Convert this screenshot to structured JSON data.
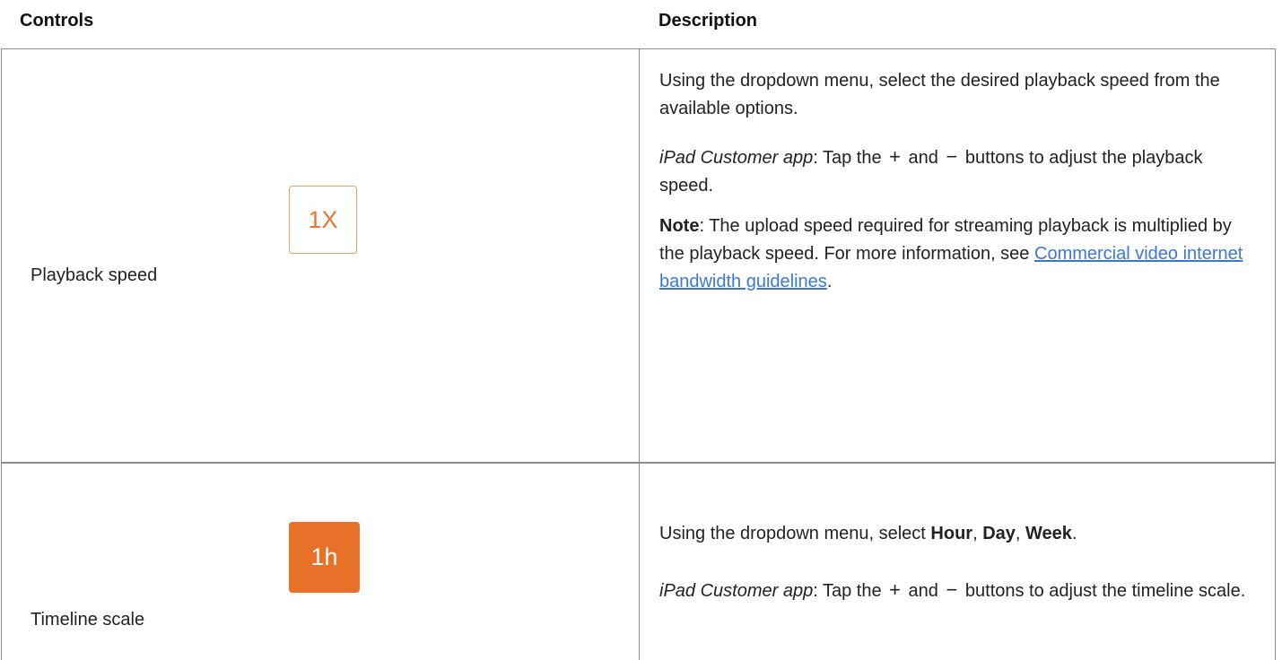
{
  "headers": {
    "controls": "Controls",
    "description": "Description"
  },
  "rows": [
    {
      "control_label": "Playback speed",
      "icon_text": "1X",
      "desc1": "Using the dropdown menu, select the desired playback speed from the available options.",
      "desc2_italic": "iPad Customer app",
      "desc2_a": ": Tap the ",
      "plus": "+",
      "desc2_b": " and ",
      "minus": "−",
      "desc2_c": " buttons to adjust the playback speed.",
      "note_bold": "Note",
      "note_text": ": The upload speed required for streaming playback is multiplied by the playback speed. For more information, see ",
      "link_text": "Commercial video internet bandwidth guidelines",
      "note_end": "."
    },
    {
      "control_label": "Timeline scale",
      "icon_text": "1h",
      "desc1_a": "Using the dropdown menu, select ",
      "hour": "Hour",
      "sep1": ", ",
      "day": "Day",
      "sep2": ", ",
      "week": "Week",
      "desc1_end": ".",
      "desc2_italic": "iPad Customer app",
      "desc2_a": ": Tap the ",
      "plus": "+",
      "desc2_b": " and ",
      "minus": "−",
      "desc2_c": " buttons to adjust the timeline scale."
    }
  ],
  "colors": {
    "accent": "#e8712a",
    "link": "#3b78d4",
    "border": "#8c8c8c"
  }
}
